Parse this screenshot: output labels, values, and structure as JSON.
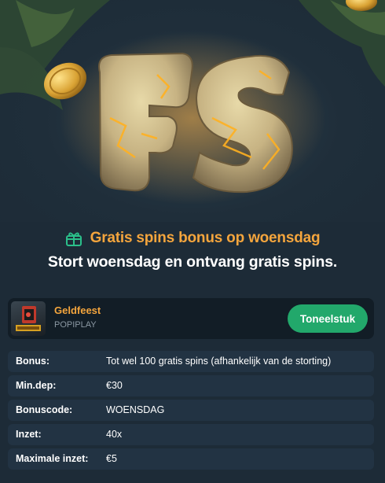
{
  "hero": {
    "image_text": "FS",
    "icons": [
      "coin-icon"
    ]
  },
  "promo": {
    "icon": "gift-icon",
    "title": "Gratis spins bonus op woensdag",
    "subtitle": "Stort woensdag en ontvang gratis spins."
  },
  "game": {
    "name": "Geldfeest",
    "provider": "POPIPLAY",
    "play_label": "Toneelstuk"
  },
  "details": [
    {
      "label": "Bonus:",
      "value": "Tot wel 100 gratis spins (afhankelijk van de storting)"
    },
    {
      "label": "Min.dep:",
      "value": "€30"
    },
    {
      "label": "Bonuscode:",
      "value": "WOENSDAG"
    },
    {
      "label": "Inzet:",
      "value": "40x"
    },
    {
      "label": "Maximale inzet:",
      "value": "€5"
    }
  ],
  "colors": {
    "accent_orange": "#f4a53d",
    "button_green": "#22a86b",
    "background": "#1d2b37",
    "row_background": "#223343"
  }
}
